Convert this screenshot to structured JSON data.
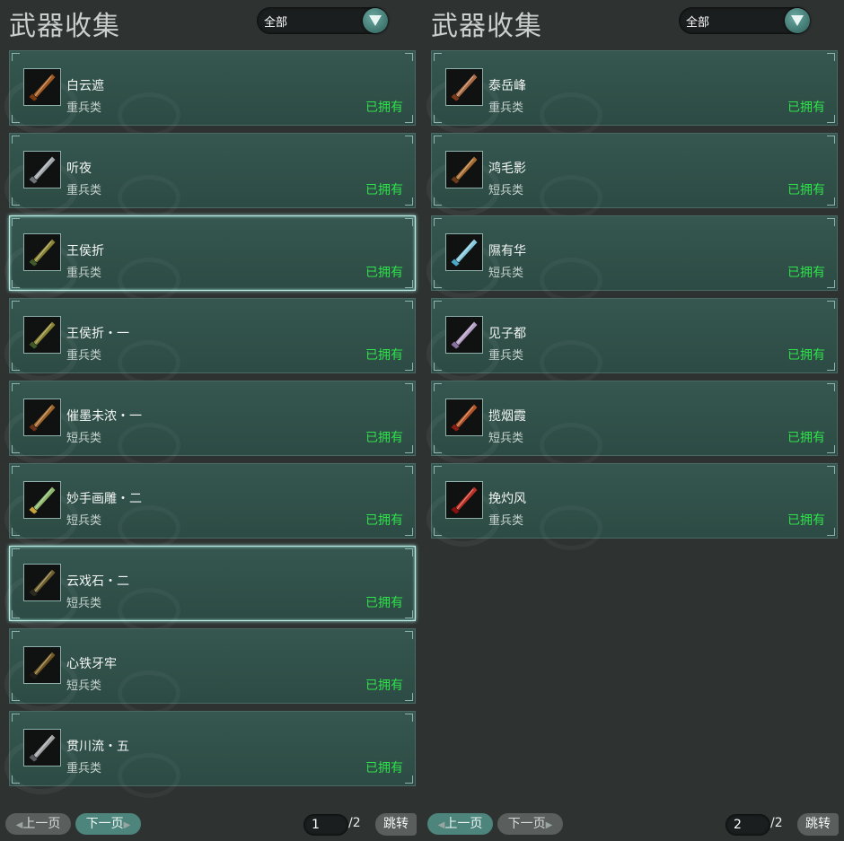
{
  "panels": [
    {
      "title": "武器收集",
      "filter": {
        "label": "全部"
      },
      "items": [
        {
          "name": "白云遮",
          "category": "重兵类",
          "status": "已拥有",
          "icon": "bronze-blade-icon",
          "selected": false
        },
        {
          "name": "听夜",
          "category": "重兵类",
          "status": "已拥有",
          "icon": "silver-blade-icon",
          "selected": false
        },
        {
          "name": "王侯折",
          "category": "重兵类",
          "status": "已拥有",
          "icon": "gold-green-blade-icon",
          "selected": true
        },
        {
          "name": "王侯折・一",
          "category": "重兵类",
          "status": "已拥有",
          "icon": "gold-green-blade-icon",
          "selected": false
        },
        {
          "name": "催墨未浓・一",
          "category": "短兵类",
          "status": "已拥有",
          "icon": "ornate-dagger-icon",
          "selected": false
        },
        {
          "name": "妙手画雕・二",
          "category": "短兵类",
          "status": "已拥有",
          "icon": "jade-dagger-icon",
          "selected": false
        },
        {
          "name": "云戏石・二",
          "category": "短兵类",
          "status": "已拥有",
          "icon": "dark-gold-dagger-icon",
          "selected": true
        },
        {
          "name": "心铁牙牢",
          "category": "短兵类",
          "status": "已拥有",
          "icon": "black-gold-dagger-icon",
          "selected": false
        },
        {
          "name": "贯川流・五",
          "category": "重兵类",
          "status": "已拥有",
          "icon": "silver-crescent-blade-icon",
          "selected": false
        }
      ],
      "pager": {
        "prev": "上一页",
        "next": "下一页",
        "current_page": "1",
        "total": "/2",
        "jump": "跳转",
        "prev_enabled": false,
        "next_enabled": true
      }
    },
    {
      "title": "武器收集",
      "filter": {
        "label": "全部"
      },
      "items": [
        {
          "name": "泰岳峰",
          "category": "重兵类",
          "status": "已拥有",
          "icon": "bronze-hammer-icon",
          "selected": false
        },
        {
          "name": "鸿毛影",
          "category": "短兵类",
          "status": "已拥有",
          "icon": "bronze-dagger-icon",
          "selected": false
        },
        {
          "name": "隰有华",
          "category": "短兵类",
          "status": "已拥有",
          "icon": "ice-dagger-icon",
          "selected": false
        },
        {
          "name": "见子都",
          "category": "重兵类",
          "status": "已拥有",
          "icon": "crystal-blade-icon",
          "selected": false
        },
        {
          "name": "揽烟霞",
          "category": "短兵类",
          "status": "已拥有",
          "icon": "crimson-dagger-icon",
          "selected": false
        },
        {
          "name": "挽灼风",
          "category": "重兵类",
          "status": "已拥有",
          "icon": "ruby-blade-icon",
          "selected": false
        }
      ],
      "pager": {
        "prev": "上一页",
        "next": "下一页",
        "current_page": "2",
        "total": "/2",
        "jump": "跳转",
        "prev_enabled": true,
        "next_enabled": false
      }
    }
  ],
  "colors": {
    "background": "#2e3231",
    "card": "#2f514a",
    "owned_status": "#2ee24a",
    "accent": "#4d857d"
  }
}
